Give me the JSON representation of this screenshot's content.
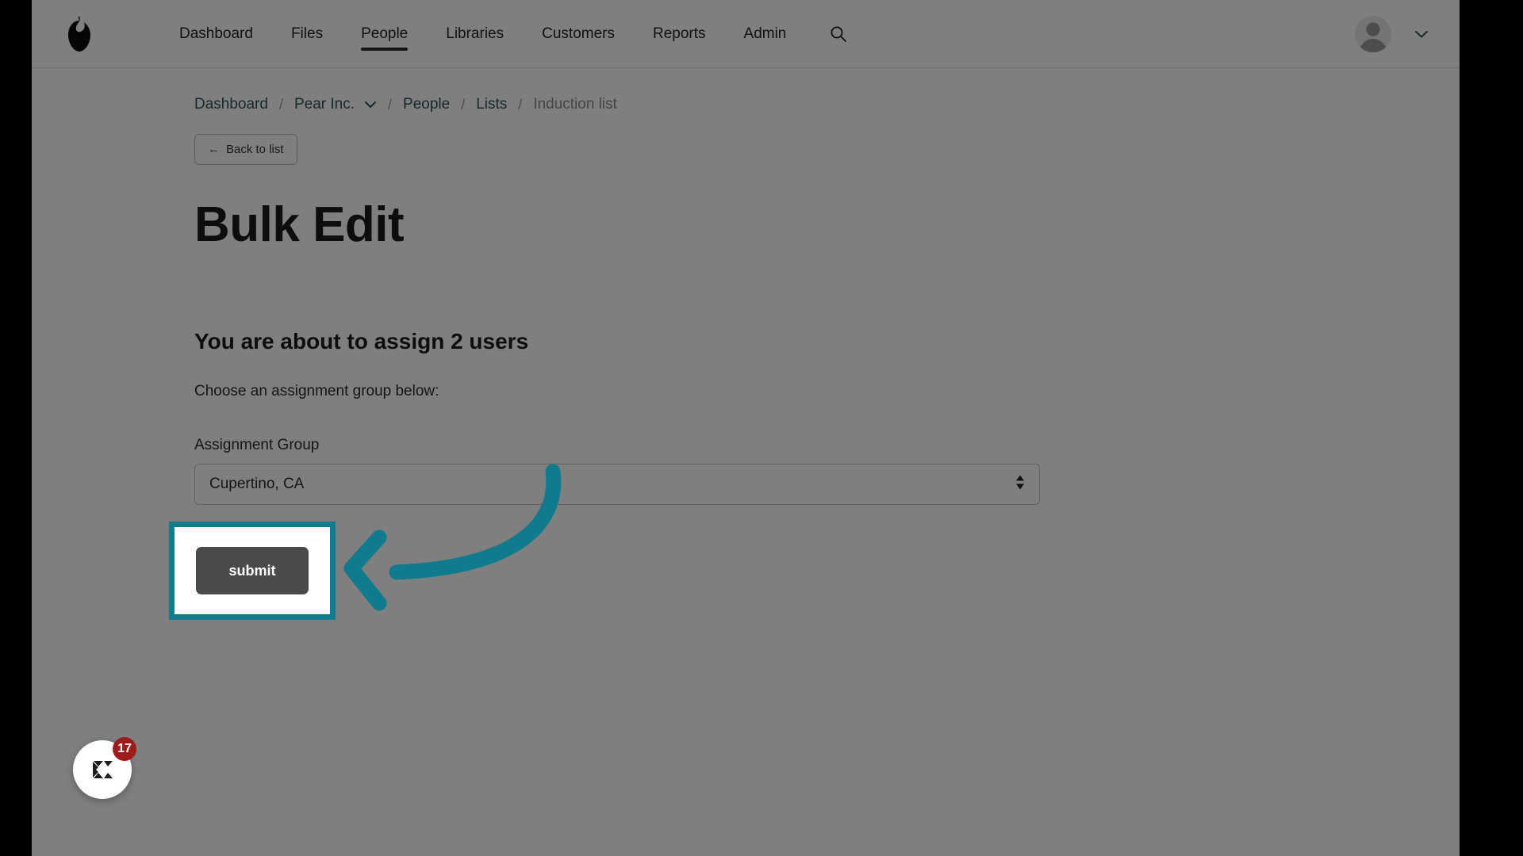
{
  "colors": {
    "annotation_teal": "#107b8c",
    "breadcrumb_link": "#2d5358",
    "submit_bg": "#4a4a4a",
    "badge_red": "#9e1b1b",
    "page_bg": "#ffffff"
  },
  "navbar": {
    "logo_name": "pear-logo",
    "links": [
      {
        "label": "Dashboard",
        "active": false
      },
      {
        "label": "Files",
        "active": false
      },
      {
        "label": "People",
        "active": true
      },
      {
        "label": "Libraries",
        "active": false
      },
      {
        "label": "Customers",
        "active": false
      },
      {
        "label": "Reports",
        "active": false
      },
      {
        "label": "Admin",
        "active": false
      }
    ],
    "search_icon": "search-icon",
    "avatar_icon": "user-avatar-placeholder",
    "account_caret_icon": "chevron-down-icon"
  },
  "breadcrumb": {
    "items": [
      {
        "label": "Dashboard",
        "muted": false,
        "caret": false
      },
      {
        "label": "Pear Inc.",
        "muted": false,
        "caret": true
      },
      {
        "label": "People",
        "muted": false,
        "caret": false
      },
      {
        "label": "Lists",
        "muted": false,
        "caret": false
      },
      {
        "label": "Induction list",
        "muted": true,
        "caret": false
      }
    ],
    "separator": "/"
  },
  "back_button": {
    "arrow": "←",
    "label": "Back to list"
  },
  "main": {
    "page_title": "Bulk Edit",
    "section_title": "You are about to assign 2 users",
    "instruction": "Choose an assignment group below:",
    "field_label": "Assignment Group",
    "select_value": "Cupertino, CA",
    "select_options": [
      "Cupertino, CA"
    ],
    "submit_label": "submit"
  },
  "annotation": {
    "arrow_icon": "curved-arrow-left",
    "highlight_target": "submit-button"
  },
  "launcher": {
    "icon": "chat-launcher-icon",
    "badge_count": "17"
  }
}
